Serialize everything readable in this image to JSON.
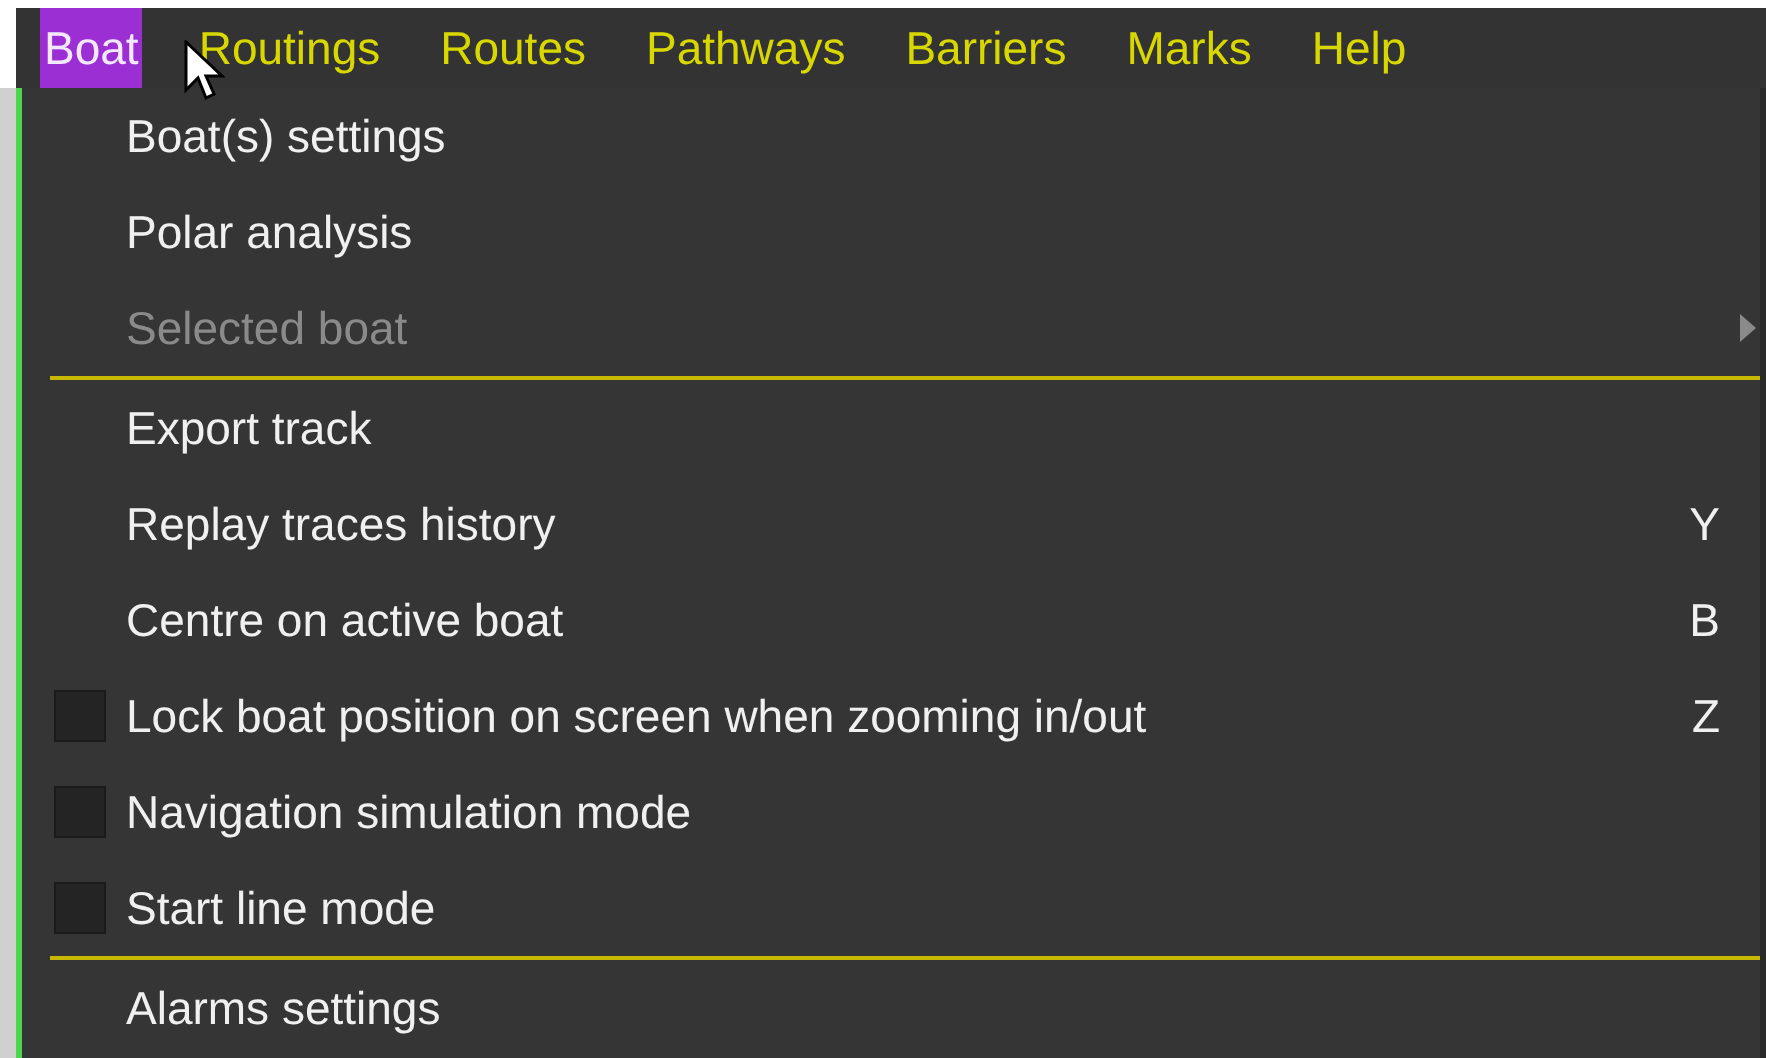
{
  "menubar": [
    {
      "label": "Boat",
      "selected": true
    },
    {
      "label": "Routings",
      "selected": false
    },
    {
      "label": "Routes",
      "selected": false
    },
    {
      "label": "Pathways",
      "selected": false
    },
    {
      "label": "Barriers",
      "selected": false
    },
    {
      "label": "Marks",
      "selected": false
    },
    {
      "label": "Help",
      "selected": false
    }
  ],
  "menu": [
    {
      "kind": "item",
      "label": "Boat(s) settings",
      "disabled": false
    },
    {
      "kind": "item",
      "label": "Polar analysis",
      "disabled": false
    },
    {
      "kind": "submenu",
      "label": "Selected boat",
      "disabled": true
    },
    {
      "kind": "separator"
    },
    {
      "kind": "item",
      "label": "Export track",
      "disabled": false
    },
    {
      "kind": "item",
      "label": "Replay traces history",
      "disabled": false,
      "shortcut": "Y"
    },
    {
      "kind": "item",
      "label": "Centre on active boat",
      "disabled": false,
      "shortcut": "B"
    },
    {
      "kind": "checkbox",
      "label": "Lock boat position on screen when zooming in/out",
      "disabled": false,
      "checked": false,
      "shortcut": "Z"
    },
    {
      "kind": "checkbox",
      "label": "Navigation simulation mode",
      "disabled": false,
      "checked": false
    },
    {
      "kind": "checkbox",
      "label": "Start line mode",
      "disabled": false,
      "checked": false
    },
    {
      "kind": "separator"
    },
    {
      "kind": "item",
      "label": "Alarms settings",
      "disabled": false
    }
  ]
}
